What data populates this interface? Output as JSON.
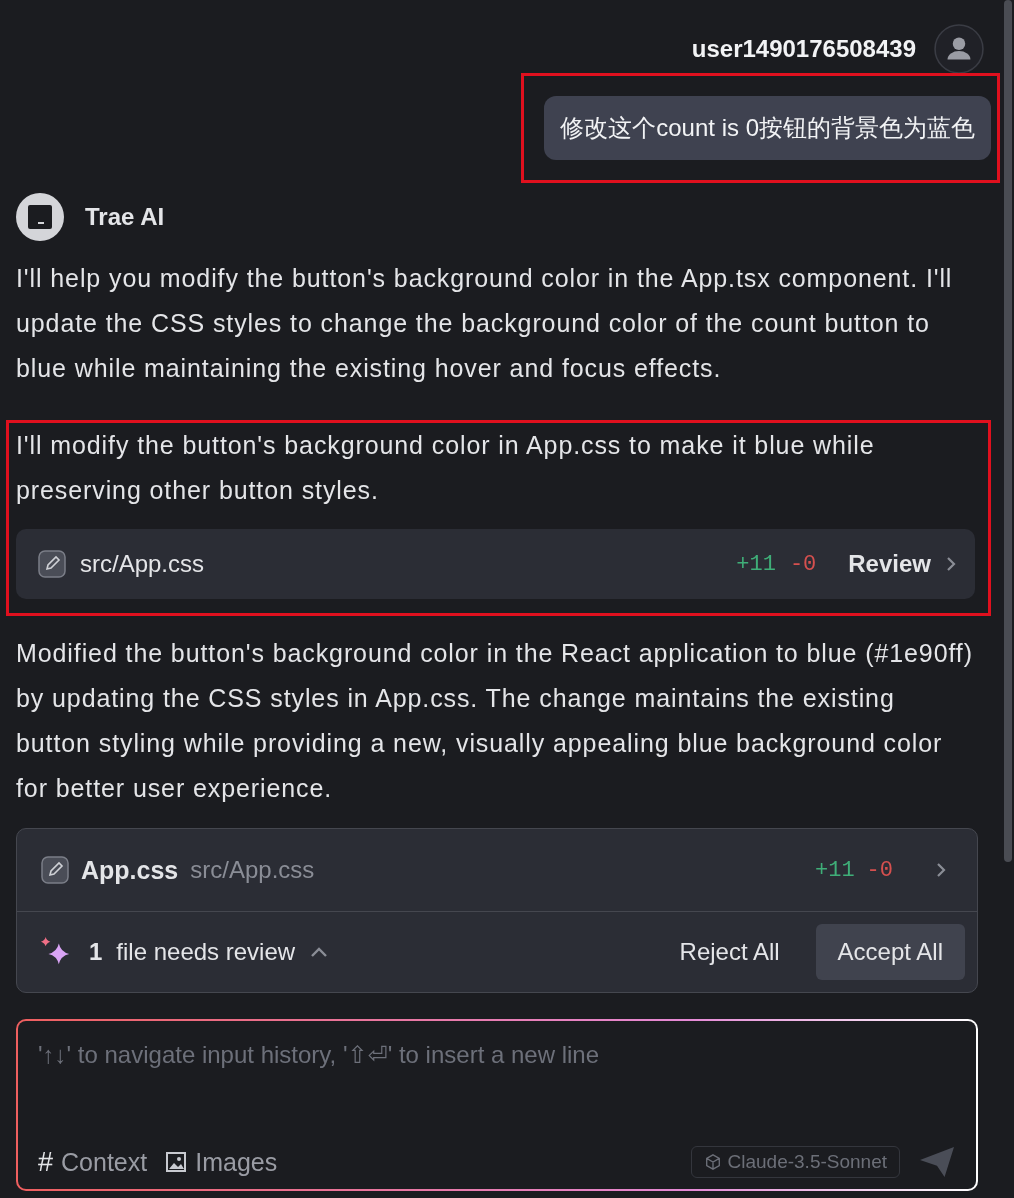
{
  "user": {
    "name": "user1490176508439",
    "message": "修改这个count is 0按钮的背景色为蓝色",
    "highlighted": true
  },
  "assistant": {
    "name": "Trae AI",
    "blocks": [
      {
        "kind": "text",
        "highlighted": false,
        "text": "I'll help you modify the button's background color in the App.tsx component. I'll update the CSS styles to change the background color of the count button to blue while maintaining the existing hover and focus effects."
      },
      {
        "kind": "change",
        "highlighted": true,
        "text": "I'll modify the button's background color in App.css to make it blue while preserving other button styles.",
        "file": {
          "path": "src/App.css",
          "added": "+11",
          "removed": "-0",
          "action": "Review"
        }
      },
      {
        "kind": "text",
        "highlighted": false,
        "text": "Modified the button's background color in the React application to blue (#1e90ff) by updating the CSS styles in App.css. The change maintains the existing button styling while providing a new, visually appealing blue background color for better user experience."
      }
    ]
  },
  "review_panel": {
    "file_name": "App.css",
    "file_path": "src/App.css",
    "added": "+11",
    "removed": "-0",
    "count": "1",
    "label": "file needs review",
    "expanded": true,
    "buttons": [
      {
        "label": "Reject All",
        "kind": "plain"
      },
      {
        "label": "Accept All",
        "kind": "filled"
      }
    ]
  },
  "composer": {
    "placeholder": "'↑↓' to navigate input history, '⇧⏎' to insert a new line",
    "context_icon": "#",
    "context": "Context",
    "images": "Images",
    "model": "Claude-3.5-Sonnet"
  }
}
